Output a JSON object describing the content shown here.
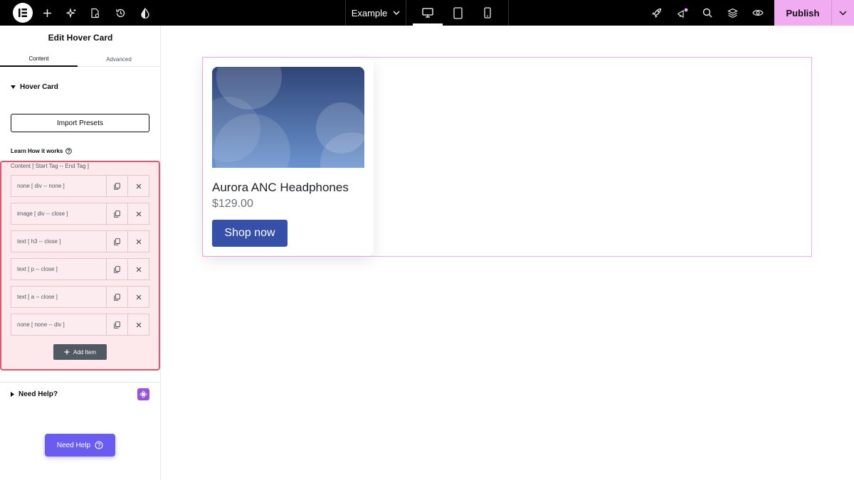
{
  "topbar": {
    "page_selector": "Example",
    "publish_label": "Publish",
    "icons": [
      "elementor-logo-icon",
      "plus-icon",
      "sparkle-icon",
      "page-settings-icon",
      "history-icon",
      "contrast-icon",
      "desktop-icon",
      "tablet-icon",
      "mobile-icon",
      "rocket-icon",
      "notifications-icon",
      "search-icon",
      "layers-icon",
      "eye-icon",
      "chevron-down-icon"
    ],
    "accent_color": "#f0abf1"
  },
  "panel": {
    "title": "Edit Hover Card",
    "tabs": [
      {
        "label": "Content",
        "active": true
      },
      {
        "label": "Advanced",
        "active": false
      }
    ],
    "section_title": "Hover Card",
    "import_presets": "Import Presets",
    "learn_link": "Learn How it works",
    "repeater_label": "Content [ Start Tag -- End Tag ]",
    "items": [
      {
        "label": "none [ div -- none ]"
      },
      {
        "label": "image [ div -- close ]"
      },
      {
        "label": "text [ h3 -- close ]"
      },
      {
        "label": "text [ p -- close ]"
      },
      {
        "label": "text [ a -- close ]"
      },
      {
        "label": "none [ none -- div ]"
      }
    ],
    "add_item": "Add Item",
    "need_help_section": "Need Help?",
    "need_help_button": "Need Help",
    "highlight_color": "#e2566e"
  },
  "card": {
    "title": "Aurora ANC Headphones",
    "price": "$129.00",
    "button": "Shop now",
    "button_color": "#3450a8"
  }
}
